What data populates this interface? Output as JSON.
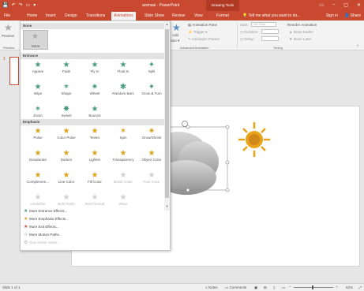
{
  "titlebar": {
    "title": "animasi - PowerPoint",
    "context_tab": "Drawing Tools",
    "qat": [
      "💾",
      "↶",
      "↷",
      "▭",
      "▾"
    ],
    "win_buttons": [
      "▭",
      "–",
      "▢",
      "✕"
    ]
  },
  "tabs": [
    {
      "label": "File",
      "active": false
    },
    {
      "label": "Home",
      "active": false
    },
    {
      "label": "Insert",
      "active": false
    },
    {
      "label": "Design",
      "active": false
    },
    {
      "label": "Transitions",
      "active": false
    },
    {
      "label": "Animations",
      "active": true
    },
    {
      "label": "Slide Show",
      "active": false
    },
    {
      "label": "Review",
      "active": false
    },
    {
      "label": "View",
      "active": false
    },
    {
      "label": "Format",
      "active": false
    }
  ],
  "tell_me": "Tell me what you want to do...",
  "sign_in": "Sign in",
  "share": "Share",
  "ribbon": {
    "preview": "Preview",
    "preview_group": "Preview",
    "add_animation": "Add",
    "add_animation_2": "ation ▾",
    "animation_pane": "Animation Pane",
    "trigger": "Trigger ▾",
    "animation_painter": "Animation Painter",
    "advanced_group": "Advanced Animation",
    "start_label": "Start:",
    "start_value": "On Click",
    "duration_label": "Duration:",
    "delay_label": "Delay:",
    "timing_group": "Timing",
    "reorder": "Reorder Animation",
    "move_earlier": "▲ Move Earlier",
    "move_later": "▼ Move Later"
  },
  "gallery": {
    "none_header": "None",
    "none_item": "None",
    "entrance_header": "Entrance",
    "entrance": [
      {
        "label": "Appear",
        "icon": "★"
      },
      {
        "label": "Fade",
        "icon": "★"
      },
      {
        "label": "Fly In",
        "icon": "★"
      },
      {
        "label": "Float In",
        "icon": "★"
      },
      {
        "label": "Split",
        "icon": "✦"
      },
      {
        "label": "Wipe",
        "icon": "★"
      },
      {
        "label": "Shape",
        "icon": "✶"
      },
      {
        "label": "Wheel",
        "icon": "✷"
      },
      {
        "label": "Random Bars",
        "icon": "✱"
      },
      {
        "label": "Grow & Turn",
        "icon": "✦"
      },
      {
        "label": "Zoom",
        "icon": "✶"
      },
      {
        "label": "Swivel",
        "icon": "✸"
      },
      {
        "label": "Bounce",
        "icon": "★"
      }
    ],
    "emphasis_header": "Emphasis",
    "emphasis": [
      {
        "label": "Pulse",
        "icon": "★",
        "disabled": false
      },
      {
        "label": "Color Pulse",
        "icon": "★",
        "disabled": false
      },
      {
        "label": "Teeter",
        "icon": "★",
        "disabled": false
      },
      {
        "label": "Spin",
        "icon": "✶",
        "disabled": false
      },
      {
        "label": "Grow/Shrink",
        "icon": "✷",
        "disabled": false
      },
      {
        "label": "Desaturate",
        "icon": "★",
        "disabled": false
      },
      {
        "label": "Darken",
        "icon": "★",
        "disabled": false
      },
      {
        "label": "Lighten",
        "icon": "★",
        "disabled": false
      },
      {
        "label": "Transparency",
        "icon": "★",
        "disabled": false
      },
      {
        "label": "Object Color",
        "icon": "★",
        "disabled": false
      },
      {
        "label": "Complemen...",
        "icon": "★",
        "disabled": false
      },
      {
        "label": "Line Color",
        "icon": "★",
        "disabled": false
      },
      {
        "label": "Fill Color",
        "icon": "★",
        "disabled": false
      },
      {
        "label": "Brush Color",
        "icon": "★",
        "disabled": true
      },
      {
        "label": "Font Color",
        "icon": "★",
        "disabled": true
      },
      {
        "label": "Underline",
        "icon": "★",
        "disabled": true
      },
      {
        "label": "Bold Flash",
        "icon": "★",
        "disabled": true
      },
      {
        "label": "Bold Reveal",
        "icon": "★",
        "disabled": true
      },
      {
        "label": "Wave",
        "icon": "★",
        "disabled": true
      }
    ],
    "more": [
      {
        "label": "More Entrance Effects...",
        "icon": "★",
        "color": "#4a9b7f",
        "disabled": false
      },
      {
        "label": "More Emphasis Effects...",
        "icon": "★",
        "color": "#d9a520",
        "disabled": false
      },
      {
        "label": "More Exit Effects...",
        "icon": "★",
        "color": "#c8492f",
        "disabled": false
      },
      {
        "label": "More Motion Paths...",
        "icon": "☆",
        "color": "#777777",
        "disabled": false
      },
      {
        "label": "OLE Action Verbs...",
        "icon": "⚙",
        "color": "#b3b3b3",
        "disabled": true
      }
    ]
  },
  "slide": {
    "number": "1"
  },
  "status": {
    "slide_info": "Slide 1 of 1",
    "notes": "Notes",
    "comments": "Comments",
    "zoom": "62%"
  },
  "colors": {
    "accent": "#c8492f",
    "entrance": "#4a9b7f",
    "emphasis": "#d9a520",
    "sun": "#e8a317"
  }
}
